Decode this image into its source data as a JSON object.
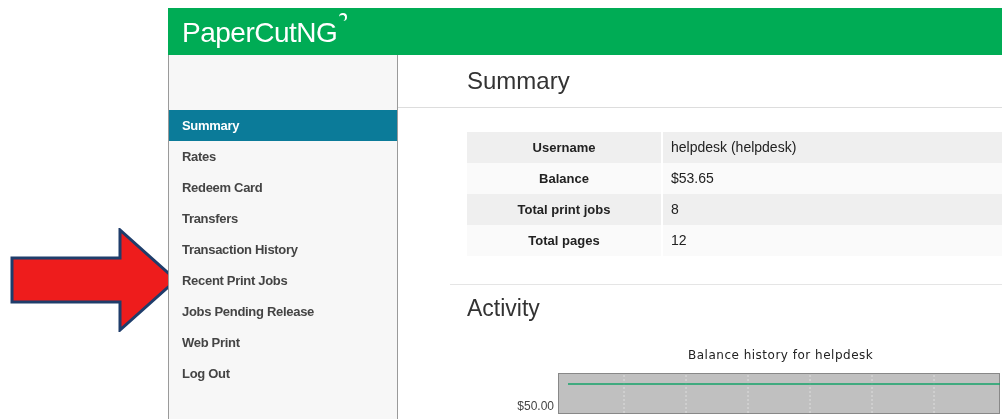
{
  "header": {
    "logo": "PaperCut",
    "logo_suffix": "NG"
  },
  "sidebar": {
    "items": [
      {
        "label": "Summary",
        "selected": true
      },
      {
        "label": "Rates",
        "selected": false
      },
      {
        "label": "Redeem Card",
        "selected": false
      },
      {
        "label": "Transfers",
        "selected": false
      },
      {
        "label": "Transaction History",
        "selected": false
      },
      {
        "label": "Recent Print Jobs",
        "selected": false
      },
      {
        "label": "Jobs Pending Release",
        "selected": false
      },
      {
        "label": "Web Print",
        "selected": false
      },
      {
        "label": "Log Out",
        "selected": false
      }
    ]
  },
  "summary": {
    "title": "Summary",
    "rows": [
      {
        "label": "Username",
        "value": "helpdesk (helpdesk)"
      },
      {
        "label": "Balance",
        "value": "$53.65"
      },
      {
        "label": "Total print jobs",
        "value": "8"
      },
      {
        "label": "Total pages",
        "value": "12"
      }
    ]
  },
  "activity": {
    "title": "Activity",
    "chart": {
      "title": "Balance history for helpdesk",
      "tick_label": "$50.00"
    }
  }
}
